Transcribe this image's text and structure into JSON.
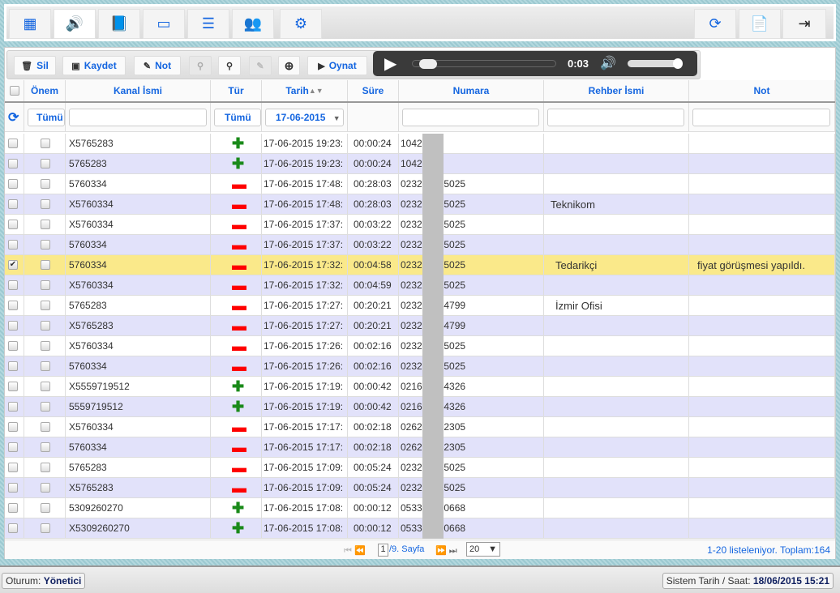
{
  "topbar": {
    "left": [
      {
        "icon": "grid-icon",
        "glyph": "▦"
      },
      {
        "icon": "audio-file-icon",
        "glyph": "🔊"
      },
      {
        "icon": "book-icon",
        "glyph": "📘"
      },
      {
        "icon": "drive-icon",
        "glyph": "▭"
      },
      {
        "icon": "list-icon",
        "glyph": "☰"
      },
      {
        "icon": "users-icon",
        "glyph": "👥"
      },
      {
        "icon": "gear-icon",
        "glyph": "⚙"
      }
    ],
    "right": [
      {
        "icon": "refresh-icon",
        "glyph": "⟳"
      },
      {
        "icon": "pdf-icon",
        "glyph": "📄"
      },
      {
        "icon": "logout-icon",
        "glyph": "⇥"
      }
    ]
  },
  "toolbar": {
    "delete": "Sil",
    "save": "Kaydet",
    "note": "Not",
    "play": "Oynat"
  },
  "player": {
    "time": "0:03",
    "progress": 0.05,
    "volume": 1.0
  },
  "columns": {
    "onem": "Önem",
    "kanal": "Kanal İsmi",
    "tur": "Tür",
    "tarih": "Tarih",
    "sure": "Süre",
    "numara": "Numara",
    "rehber": "Rehber İsmi",
    "not": "Not"
  },
  "filters": {
    "onem": "Tümü",
    "tur": "Tümü",
    "tarih": "17-06-2015"
  },
  "rows": [
    {
      "sel": false,
      "kanal": "X5765283",
      "tur": "+",
      "tarih": "17-06-2015 19:23:",
      "sure": "00:00:24",
      "num_a": "10420",
      "num_b": "",
      "rehber": "",
      "not": ""
    },
    {
      "sel": false,
      "kanal": "5765283",
      "tur": "+",
      "tarih": "17-06-2015 19:23:",
      "sure": "00:00:24",
      "num_a": "10420",
      "num_b": "",
      "rehber": "",
      "not": ""
    },
    {
      "sel": false,
      "kanal": "5760334",
      "tur": "-",
      "tarih": "17-06-2015 17:48:",
      "sure": "00:28:03",
      "num_a": "02326",
      "num_b": "5025",
      "rehber": "",
      "not": ""
    },
    {
      "sel": false,
      "kanal": "X5760334",
      "tur": "-",
      "tarih": "17-06-2015 17:48:",
      "sure": "00:28:03",
      "num_a": "02326",
      "num_b": "5025",
      "rehber": "Teknikom",
      "not": ""
    },
    {
      "sel": false,
      "kanal": "X5760334",
      "tur": "-",
      "tarih": "17-06-2015 17:37:",
      "sure": "00:03:22",
      "num_a": "02326",
      "num_b": "5025",
      "rehber": "",
      "not": ""
    },
    {
      "sel": false,
      "kanal": "5760334",
      "tur": "-",
      "tarih": "17-06-2015 17:37:",
      "sure": "00:03:22",
      "num_a": "02326",
      "num_b": "5025",
      "rehber": "",
      "not": ""
    },
    {
      "sel": true,
      "kanal": "5760334",
      "tur": "-",
      "tarih": "17-06-2015 17:32:",
      "sure": "00:04:58",
      "num_a": "02326",
      "num_b": "5025",
      "rehber": "Tedarikçi",
      "not": "fiyat görüşmesi yapıldı."
    },
    {
      "sel": false,
      "kanal": "X5760334",
      "tur": "-",
      "tarih": "17-06-2015 17:32:",
      "sure": "00:04:59",
      "num_a": "02326",
      "num_b": "5025",
      "rehber": "",
      "not": ""
    },
    {
      "sel": false,
      "kanal": "5765283",
      "tur": "-",
      "tarih": "17-06-2015 17:27:",
      "sure": "00:20:21",
      "num_a": "02324",
      "num_b": "4799",
      "rehber": "İzmir Ofisi",
      "not": ""
    },
    {
      "sel": false,
      "kanal": "X5765283",
      "tur": "-",
      "tarih": "17-06-2015 17:27:",
      "sure": "00:20:21",
      "num_a": "02324",
      "num_b": "4799",
      "rehber": "",
      "not": ""
    },
    {
      "sel": false,
      "kanal": "X5760334",
      "tur": "-",
      "tarih": "17-06-2015 17:26:",
      "sure": "00:02:16",
      "num_a": "02326",
      "num_b": "5025",
      "rehber": "",
      "not": ""
    },
    {
      "sel": false,
      "kanal": "5760334",
      "tur": "-",
      "tarih": "17-06-2015 17:26:",
      "sure": "00:02:16",
      "num_a": "02326",
      "num_b": "5025",
      "rehber": "",
      "not": ""
    },
    {
      "sel": false,
      "kanal": "X5559719512",
      "tur": "+",
      "tarih": "17-06-2015 17:19:",
      "sure": "00:00:42",
      "num_a": "02165",
      "num_b": "4326",
      "rehber": "",
      "not": ""
    },
    {
      "sel": false,
      "kanal": "5559719512",
      "tur": "+",
      "tarih": "17-06-2015 17:19:",
      "sure": "00:00:42",
      "num_a": "02165",
      "num_b": "4326",
      "rehber": "",
      "not": ""
    },
    {
      "sel": false,
      "kanal": "X5760334",
      "tur": "-",
      "tarih": "17-06-2015 17:17:",
      "sure": "00:02:18",
      "num_a": "02626",
      "num_b": "2305",
      "rehber": "",
      "not": ""
    },
    {
      "sel": false,
      "kanal": "5760334",
      "tur": "-",
      "tarih": "17-06-2015 17:17:",
      "sure": "00:02:18",
      "num_a": "02626",
      "num_b": "2305",
      "rehber": "",
      "not": ""
    },
    {
      "sel": false,
      "kanal": "5765283",
      "tur": "-",
      "tarih": "17-06-2015 17:09:",
      "sure": "00:05:24",
      "num_a": "02326",
      "num_b": "5025",
      "rehber": "",
      "not": ""
    },
    {
      "sel": false,
      "kanal": "X5765283",
      "tur": "-",
      "tarih": "17-06-2015 17:09:",
      "sure": "00:05:24",
      "num_a": "02326",
      "num_b": "5025",
      "rehber": "",
      "not": ""
    },
    {
      "sel": false,
      "kanal": "5309260270",
      "tur": "+",
      "tarih": "17-06-2015 17:08:",
      "sure": "00:00:12",
      "num_a": "05332",
      "num_b": "0668",
      "rehber": "",
      "not": ""
    },
    {
      "sel": false,
      "kanal": "X5309260270",
      "tur": "+",
      "tarih": "17-06-2015 17:08:",
      "sure": "00:00:12",
      "num_a": "05332",
      "num_b": "0668",
      "rehber": "",
      "not": ""
    }
  ],
  "pager": {
    "page": "1",
    "of": "/9. Sayfa",
    "size": "20",
    "summary": "1-20 listeleniyor. Toplam:164"
  },
  "status": {
    "session_label": "Oturum:",
    "session_user": "Yönetici",
    "clock_label": "Sistem Tarih / Saat:",
    "clock_value": "18/06/2015 15:21"
  },
  "colors": {
    "accent": "#1566e0",
    "selected_row": "#fae98a",
    "alt_row": "#e2e2fa",
    "plus": "#1a8a1a",
    "minus": "#ff0000"
  }
}
